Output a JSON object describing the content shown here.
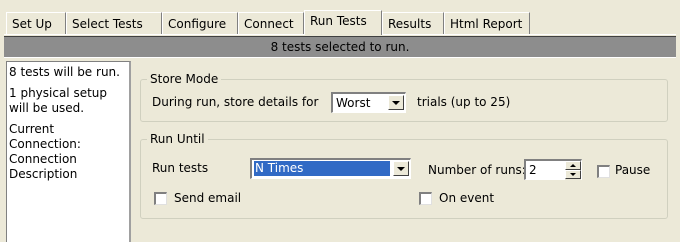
{
  "tabs": [
    "Set Up",
    "Select Tests",
    "Configure",
    "Connect",
    "Run Tests",
    "Results",
    "Html Report"
  ],
  "active_tab": "Run Tests",
  "status_message": "8 tests selected to run.",
  "info_panel": {
    "line1": "8 tests will be run.",
    "line2": "1 physical setup will be used.",
    "line3a": "Current",
    "line3b": "Connection:",
    "line4a": "Connection",
    "line4b": "Description"
  },
  "store_mode": {
    "legend": "Store Mode",
    "label_before": "During run, store details for",
    "selected": "Worst",
    "label_after": "trials (up to 25)"
  },
  "run_until": {
    "legend": "Run Until",
    "run_tests_label": "Run tests",
    "run_tests_selected": "N Times",
    "number_of_runs_label": "Number of runs:",
    "number_of_runs_value": "2",
    "pause_label": "Pause",
    "pause_checked": false,
    "send_email_label": "Send email",
    "send_email_checked": false,
    "on_event_label": "On event",
    "on_event_checked": false
  },
  "colors": {
    "window_bg": "#ece9d8",
    "status_bar_bg": "#8d8d8d",
    "selection": "#316ac5"
  }
}
